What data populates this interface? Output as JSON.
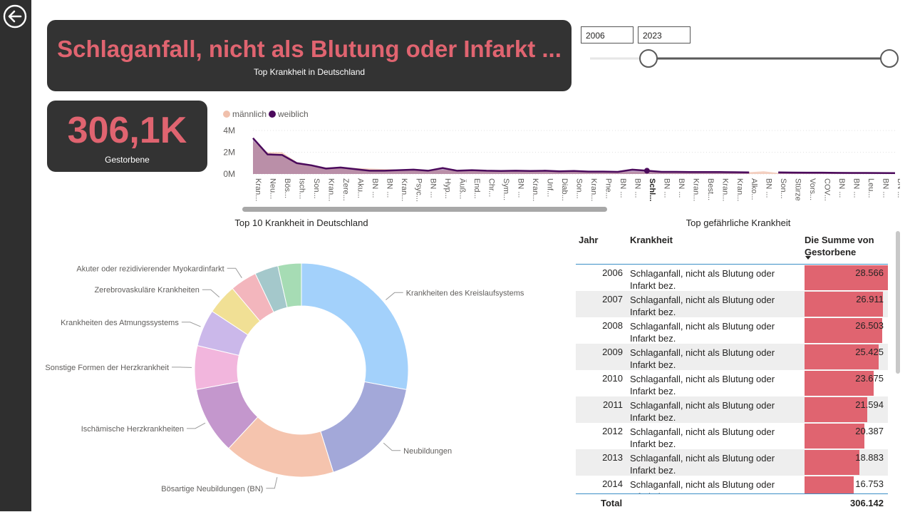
{
  "header": {
    "title": "Schlaganfall, nicht als Blutung oder Infarkt ...",
    "subtitle": "Top Krankheit in Deutschland"
  },
  "kpi": {
    "value": "306,1K",
    "label": "Gestorbene"
  },
  "year_range": {
    "from": "2006",
    "to": "2023"
  },
  "colors": {
    "accent": "#e06470",
    "card": "#333333",
    "male": "#f0c0ac",
    "female": "#4b0a5c"
  },
  "icons": {
    "back": "back-arrow-icon"
  },
  "line_chart": {
    "legend": [
      "männlich",
      "weiblich"
    ],
    "y_ticks": [
      "4M",
      "2M",
      "0M"
    ],
    "x_labels": [
      "Kran...",
      "Neu...",
      "Bös...",
      "Isch...",
      "Son...",
      "Kran...",
      "Zere...",
      "Aku...",
      "BN ...",
      "BN ...",
      "Kran...",
      "Psyc...",
      "BN ...",
      "Hyp...",
      "Äuß...",
      "End...",
      "Chr...",
      "Sym...",
      "BN ...",
      "Kran...",
      "Unf...",
      "Diab...",
      "Son...",
      "Kran...",
      "Pne...",
      "BN ...",
      "BN ...",
      "Schl...",
      "BN ...",
      "BN ...",
      "Kran...",
      "Best...",
      "Kran...",
      "Kran...",
      "Alko...",
      "BN ...",
      "Son...",
      "Stürze",
      "Vors...",
      "COV...",
      "BN ...",
      "BN ...",
      "Leu...",
      "BN ...",
      "BN ..."
    ]
  },
  "donut_title": "Top 10 Krankheit in Deutschland",
  "table_title": "Top gefährliche Krankheit",
  "chart_data": [
    {
      "type": "area",
      "series": [
        {
          "name": "männlich",
          "values": [
            3.0,
            2.0,
            2.0,
            1.1,
            0.8,
            0.6,
            0.6,
            0.55,
            0.5,
            0.45,
            0.42,
            0.4,
            0.38,
            0.36,
            0.34,
            0.32,
            0.3,
            0.3,
            0.28,
            0.28,
            0.26,
            0.25,
            0.24,
            0.24,
            0.22,
            0.22,
            0.2,
            0.2,
            0.19,
            0.19,
            0.18,
            0.18,
            0.17,
            0.17,
            0.16,
            0.25,
            0.1,
            0.14,
            0.13,
            0.13,
            0.12,
            0.12,
            0.11,
            0.11,
            0.1
          ]
        },
        {
          "name": "weiblich",
          "values": [
            3.3,
            1.8,
            1.75,
            1.0,
            0.8,
            0.5,
            0.6,
            0.45,
            0.3,
            0.3,
            0.35,
            0.4,
            0.3,
            0.55,
            0.3,
            0.35,
            0.3,
            0.28,
            0.3,
            0.28,
            0.3,
            0.25,
            0.28,
            0.22,
            0.22,
            0.2,
            0.4,
            0.3,
            0.2,
            0.2,
            0.18,
            0.18,
            0.18,
            0.16,
            0.15,
            null,
            0.15,
            0.13,
            0.12,
            0.12,
            0.11,
            0.1,
            0.1,
            0.09,
            0.08
          ]
        }
      ],
      "ylim": [
        0,
        4
      ]
    },
    {
      "type": "pie",
      "labels": [
        "Krankheiten des Kreislaufsystems",
        "Neubildungen",
        "Bösartige Neubildungen (BN)",
        "Ischämische Herzkrankheiten",
        "Sonstige Formen der Herzkrankheit",
        "Krankheiten des Atmungssystems",
        "Zerebrovaskuläre Krankheiten",
        "Akuter oder rezidivierender Myokardinfarkt",
        "",
        ""
      ],
      "values": [
        27.5,
        17.0,
        16.5,
        10.0,
        6.5,
        5.5,
        4.5,
        4.0,
        3.5,
        3.5
      ],
      "colors": [
        "#a3d1fb",
        "#a3a8d9",
        "#f5c4ae",
        "#c497cd",
        "#f2b6dd",
        "#cbb8ea",
        "#f1e095",
        "#f3b6bd",
        "#a4c8cb",
        "#a6dcb4"
      ]
    },
    {
      "type": "table",
      "columns": [
        "Jahr",
        "Krankheit",
        "Die Summe von Gestorbene"
      ],
      "rows": [
        {
          "year": "2006",
          "disease": "Schlaganfall, nicht als Blutung oder Infarkt bez.",
          "value": "28.566",
          "num": 28566
        },
        {
          "year": "2007",
          "disease": "Schlaganfall, nicht als Blutung oder Infarkt bez.",
          "value": "26.911",
          "num": 26911
        },
        {
          "year": "2008",
          "disease": "Schlaganfall, nicht als Blutung oder Infarkt bez.",
          "value": "26.503",
          "num": 26503
        },
        {
          "year": "2009",
          "disease": "Schlaganfall, nicht als Blutung oder Infarkt bez.",
          "value": "25.425",
          "num": 25425
        },
        {
          "year": "2010",
          "disease": "Schlaganfall, nicht als Blutung oder Infarkt bez.",
          "value": "23.675",
          "num": 23675
        },
        {
          "year": "2011",
          "disease": "Schlaganfall, nicht als Blutung oder Infarkt bez.",
          "value": "21.594",
          "num": 21594
        },
        {
          "year": "2012",
          "disease": "Schlaganfall, nicht als Blutung oder Infarkt bez.",
          "value": "20.387",
          "num": 20387
        },
        {
          "year": "2013",
          "disease": "Schlaganfall, nicht als Blutung oder Infarkt bez.",
          "value": "18.883",
          "num": 18883
        },
        {
          "year": "2014",
          "disease": "Schlaganfall, nicht als Blutung oder Infarkt bez.",
          "value": "16.753",
          "num": 16753
        }
      ],
      "total_label": "Total",
      "total_value": "306.142"
    }
  ]
}
